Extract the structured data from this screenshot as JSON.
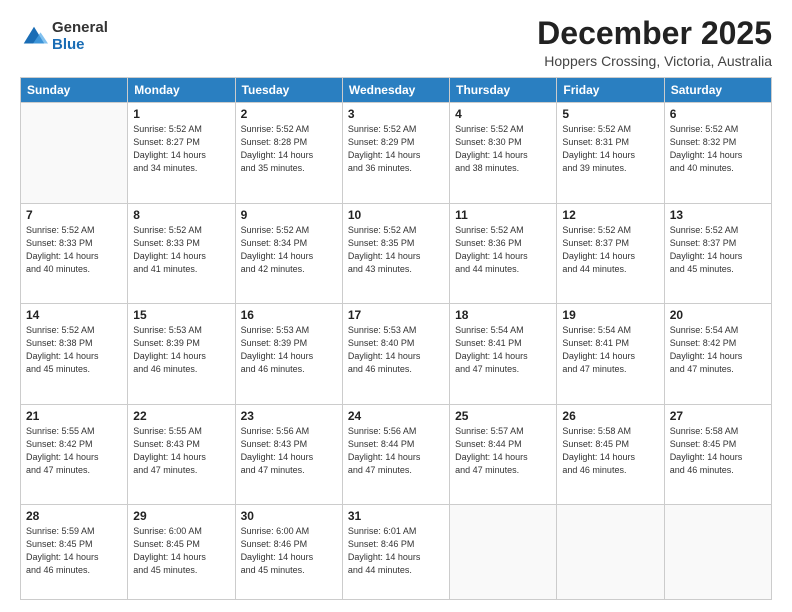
{
  "logo": {
    "general": "General",
    "blue": "Blue"
  },
  "header": {
    "month": "December 2025",
    "location": "Hoppers Crossing, Victoria, Australia"
  },
  "weekdays": [
    "Sunday",
    "Monday",
    "Tuesday",
    "Wednesday",
    "Thursday",
    "Friday",
    "Saturday"
  ],
  "weeks": [
    [
      {
        "day": "",
        "info": ""
      },
      {
        "day": "1",
        "info": "Sunrise: 5:52 AM\nSunset: 8:27 PM\nDaylight: 14 hours\nand 34 minutes."
      },
      {
        "day": "2",
        "info": "Sunrise: 5:52 AM\nSunset: 8:28 PM\nDaylight: 14 hours\nand 35 minutes."
      },
      {
        "day": "3",
        "info": "Sunrise: 5:52 AM\nSunset: 8:29 PM\nDaylight: 14 hours\nand 36 minutes."
      },
      {
        "day": "4",
        "info": "Sunrise: 5:52 AM\nSunset: 8:30 PM\nDaylight: 14 hours\nand 38 minutes."
      },
      {
        "day": "5",
        "info": "Sunrise: 5:52 AM\nSunset: 8:31 PM\nDaylight: 14 hours\nand 39 minutes."
      },
      {
        "day": "6",
        "info": "Sunrise: 5:52 AM\nSunset: 8:32 PM\nDaylight: 14 hours\nand 40 minutes."
      }
    ],
    [
      {
        "day": "7",
        "info": "Sunrise: 5:52 AM\nSunset: 8:33 PM\nDaylight: 14 hours\nand 40 minutes."
      },
      {
        "day": "8",
        "info": "Sunrise: 5:52 AM\nSunset: 8:33 PM\nDaylight: 14 hours\nand 41 minutes."
      },
      {
        "day": "9",
        "info": "Sunrise: 5:52 AM\nSunset: 8:34 PM\nDaylight: 14 hours\nand 42 minutes."
      },
      {
        "day": "10",
        "info": "Sunrise: 5:52 AM\nSunset: 8:35 PM\nDaylight: 14 hours\nand 43 minutes."
      },
      {
        "day": "11",
        "info": "Sunrise: 5:52 AM\nSunset: 8:36 PM\nDaylight: 14 hours\nand 44 minutes."
      },
      {
        "day": "12",
        "info": "Sunrise: 5:52 AM\nSunset: 8:37 PM\nDaylight: 14 hours\nand 44 minutes."
      },
      {
        "day": "13",
        "info": "Sunrise: 5:52 AM\nSunset: 8:37 PM\nDaylight: 14 hours\nand 45 minutes."
      }
    ],
    [
      {
        "day": "14",
        "info": "Sunrise: 5:52 AM\nSunset: 8:38 PM\nDaylight: 14 hours\nand 45 minutes."
      },
      {
        "day": "15",
        "info": "Sunrise: 5:53 AM\nSunset: 8:39 PM\nDaylight: 14 hours\nand 46 minutes."
      },
      {
        "day": "16",
        "info": "Sunrise: 5:53 AM\nSunset: 8:39 PM\nDaylight: 14 hours\nand 46 minutes."
      },
      {
        "day": "17",
        "info": "Sunrise: 5:53 AM\nSunset: 8:40 PM\nDaylight: 14 hours\nand 46 minutes."
      },
      {
        "day": "18",
        "info": "Sunrise: 5:54 AM\nSunset: 8:41 PM\nDaylight: 14 hours\nand 47 minutes."
      },
      {
        "day": "19",
        "info": "Sunrise: 5:54 AM\nSunset: 8:41 PM\nDaylight: 14 hours\nand 47 minutes."
      },
      {
        "day": "20",
        "info": "Sunrise: 5:54 AM\nSunset: 8:42 PM\nDaylight: 14 hours\nand 47 minutes."
      }
    ],
    [
      {
        "day": "21",
        "info": "Sunrise: 5:55 AM\nSunset: 8:42 PM\nDaylight: 14 hours\nand 47 minutes."
      },
      {
        "day": "22",
        "info": "Sunrise: 5:55 AM\nSunset: 8:43 PM\nDaylight: 14 hours\nand 47 minutes."
      },
      {
        "day": "23",
        "info": "Sunrise: 5:56 AM\nSunset: 8:43 PM\nDaylight: 14 hours\nand 47 minutes."
      },
      {
        "day": "24",
        "info": "Sunrise: 5:56 AM\nSunset: 8:44 PM\nDaylight: 14 hours\nand 47 minutes."
      },
      {
        "day": "25",
        "info": "Sunrise: 5:57 AM\nSunset: 8:44 PM\nDaylight: 14 hours\nand 47 minutes."
      },
      {
        "day": "26",
        "info": "Sunrise: 5:58 AM\nSunset: 8:45 PM\nDaylight: 14 hours\nand 46 minutes."
      },
      {
        "day": "27",
        "info": "Sunrise: 5:58 AM\nSunset: 8:45 PM\nDaylight: 14 hours\nand 46 minutes."
      }
    ],
    [
      {
        "day": "28",
        "info": "Sunrise: 5:59 AM\nSunset: 8:45 PM\nDaylight: 14 hours\nand 46 minutes."
      },
      {
        "day": "29",
        "info": "Sunrise: 6:00 AM\nSunset: 8:45 PM\nDaylight: 14 hours\nand 45 minutes."
      },
      {
        "day": "30",
        "info": "Sunrise: 6:00 AM\nSunset: 8:46 PM\nDaylight: 14 hours\nand 45 minutes."
      },
      {
        "day": "31",
        "info": "Sunrise: 6:01 AM\nSunset: 8:46 PM\nDaylight: 14 hours\nand 44 minutes."
      },
      {
        "day": "",
        "info": ""
      },
      {
        "day": "",
        "info": ""
      },
      {
        "day": "",
        "info": ""
      }
    ]
  ]
}
